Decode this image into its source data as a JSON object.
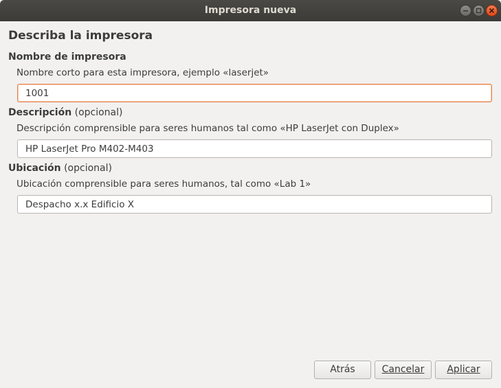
{
  "window": {
    "title": "Impresora nueva",
    "controls": [
      "minimize-icon",
      "maximize-icon",
      "close-icon"
    ]
  },
  "page": {
    "heading": "Describa la impresora"
  },
  "printer_name": {
    "label": "Nombre de impresora",
    "hint": "Nombre corto para esta impresora, ejemplo «laserjet»",
    "value": "1001"
  },
  "description": {
    "label": "Descripción",
    "optional": "(opcional)",
    "hint": "Descripción comprensible para seres humanos tal como «HP LaserJet con Duplex»",
    "value": "HP LaserJet Pro M402-M403"
  },
  "location": {
    "label": "Ubicación",
    "optional": "(opcional)",
    "hint": "Ubicación comprensible para seres humanos, tal como «Lab 1»",
    "value": "Despacho x.x Edificio X"
  },
  "buttons": {
    "back": "Atrás",
    "cancel": "Cancelar",
    "apply": "Aplicar"
  },
  "colors": {
    "titlebar": "#3c3b37",
    "background": "#f2f1f0",
    "focus_border": "#e9834f",
    "close_button": "#df4a16"
  }
}
